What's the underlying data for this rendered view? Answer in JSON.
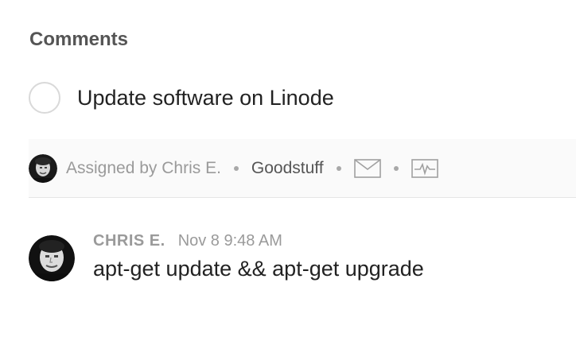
{
  "section": {
    "title": "Comments"
  },
  "task": {
    "title": "Update software on Linode",
    "completed": false
  },
  "meta": {
    "assigned": "Assigned by Chris E.",
    "project": "Goodstuff",
    "icons": [
      "avatar",
      "mail-icon",
      "activity-icon"
    ]
  },
  "comment": {
    "author": "CHRIS E.",
    "timestamp": "Nov 8 9:48 AM",
    "text": "apt-get update && apt-get upgrade"
  }
}
